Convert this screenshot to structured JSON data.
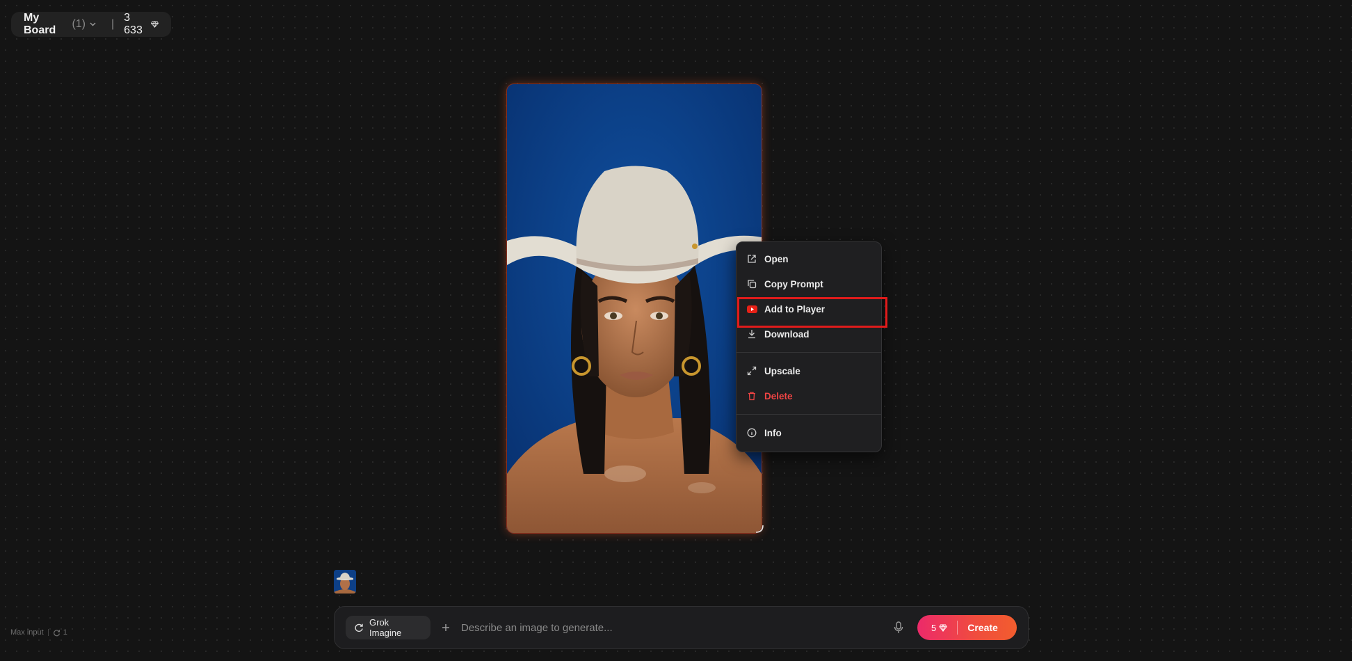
{
  "board": {
    "name": "My Board",
    "count": "(1)",
    "separator": "|",
    "credits": "3 633",
    "gem_icon": "gem-icon"
  },
  "image": {
    "description_icon": "generated-portrait-image"
  },
  "context_menu": {
    "items": [
      {
        "label": "Open",
        "icon": "external-link-icon"
      },
      {
        "label": "Copy Prompt",
        "icon": "copy-icon"
      },
      {
        "label": "Add to Player",
        "icon": "youtube-play-icon",
        "highlighted": true
      },
      {
        "label": "Download",
        "icon": "download-icon"
      },
      {
        "label": "Upscale",
        "icon": "expand-icon"
      },
      {
        "label": "Delete",
        "icon": "trash-icon",
        "color": "#ef4444"
      },
      {
        "label": "Info",
        "icon": "info-icon"
      }
    ]
  },
  "composer": {
    "model": "Grok Imagine",
    "placeholder": "Describe an image to generate...",
    "cost": "5",
    "create_label": "Create"
  },
  "footer": {
    "max_input": "Max input",
    "count": "1"
  },
  "colors": {
    "accent_start": "#ec2a6a",
    "accent_end": "#f25d2e",
    "danger": "#ef4444",
    "highlight_box": "#e01b1b"
  }
}
